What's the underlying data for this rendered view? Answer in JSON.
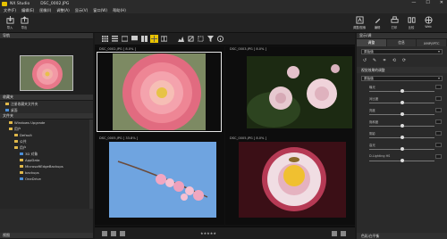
{
  "window": {
    "app_title": "NX Studio",
    "file_title": "DSC_0002.JPG",
    "controls": [
      "—",
      "☐",
      "✕"
    ]
  },
  "menu": [
    "文件(F)",
    "编辑(E)",
    "图像(I)",
    "调整(A)",
    "显示(V)",
    "窗口(W)",
    "帮助(H)"
  ],
  "toolbar": {
    "left_buttons": [
      "导入",
      "导出"
    ],
    "right_buttons": [
      "调整/图像",
      "编辑",
      "打印",
      "比较",
      "Web"
    ]
  },
  "left_panel": {
    "navigator_label": "导航",
    "favorites_label": "收藏夹",
    "favorites_items": [
      "注册收藏夹文件夹",
      "桌面"
    ],
    "folders_label": "文件夹",
    "tree": [
      {
        "label": "Windows Upgrade",
        "indent": 1,
        "kind": "folder"
      },
      {
        "label": "用户",
        "indent": 1,
        "kind": "folder"
      },
      {
        "label": "Default",
        "indent": 2,
        "kind": "folder"
      },
      {
        "label": "公共",
        "indent": 2,
        "kind": "folder"
      },
      {
        "label": "用户",
        "indent": 2,
        "kind": "folder"
      },
      {
        "label": "3D 对象",
        "indent": 3,
        "kind": "blue"
      },
      {
        "label": "AppData",
        "indent": 3,
        "kind": "folder"
      },
      {
        "label": "MicrosoftEdgeBackups",
        "indent": 3,
        "kind": "folder"
      },
      {
        "label": "backups",
        "indent": 3,
        "kind": "folder"
      },
      {
        "label": "OneDrive",
        "indent": 3,
        "kind": "blue"
      }
    ],
    "history_label": "视图"
  },
  "browser": {
    "thumbnails": [
      {
        "label": "DSC_0002.JPG [ 8.0% ]",
        "selected": true
      },
      {
        "label": "DSC_0003.JPG [ 8.0% ]",
        "selected": false
      },
      {
        "label": "DSC_0005.JPG [ 33.8% ]",
        "selected": false
      },
      {
        "label": "DSC_0005.JPG [ 8.0% ]",
        "selected": false
      }
    ],
    "rating": "★★★★★"
  },
  "right_panel": {
    "header": "显示/调",
    "tabs": [
      "调整",
      "信息",
      "XMP/IPTC"
    ],
    "preset": "原始值",
    "section_title": "视觉效果的调整",
    "section_value": "原始值",
    "sliders": [
      {
        "label": "曝光",
        "position": 0.5
      },
      {
        "label": "对比度",
        "position": 0.5
      },
      {
        "label": "亮度",
        "position": 0.5
      },
      {
        "label": "饱和度",
        "position": 0.5
      },
      {
        "label": "阴影",
        "position": 0.5
      },
      {
        "label": "高光",
        "position": 0.5
      },
      {
        "label": "D-Lighting HS",
        "position": 0.5
      }
    ],
    "footer": "色彩/白平衡"
  }
}
